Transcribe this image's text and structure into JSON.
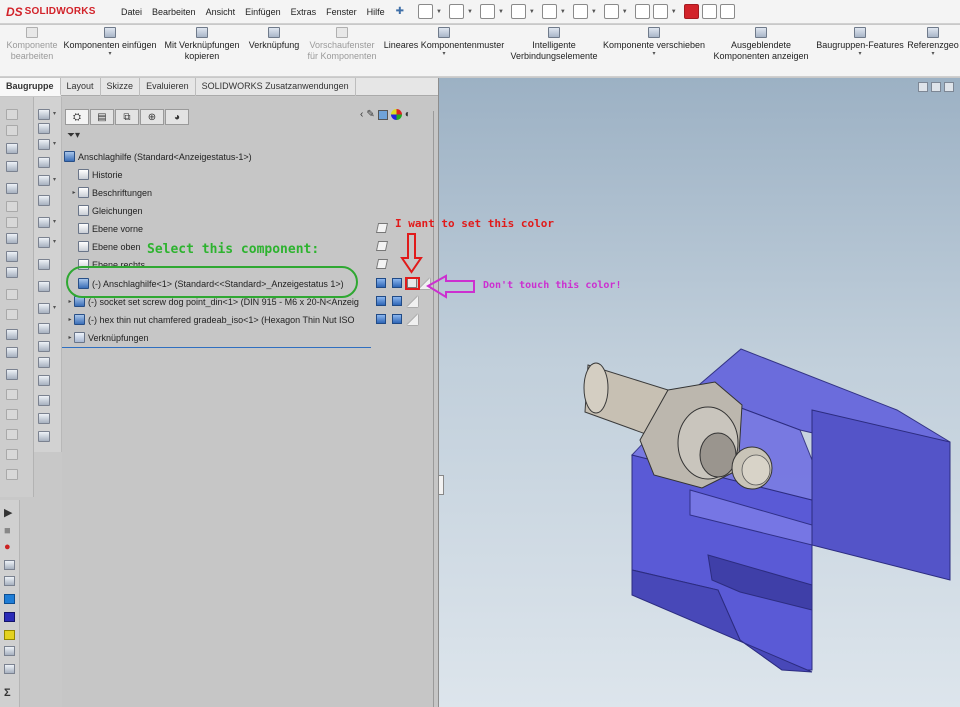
{
  "app": {
    "logo_ds": "DS",
    "logo_text": "SOLIDWORKS"
  },
  "menu": [
    "Datei",
    "Bearbeiten",
    "Ansicht",
    "Einfügen",
    "Extras",
    "Fenster",
    "Hilfe"
  ],
  "commands": [
    {
      "line1": "Komponente",
      "line2": "bearbeiten",
      "disabled": true
    },
    {
      "line1": "Komponenten einfügen",
      "line2": "",
      "disabled": false
    },
    {
      "line1": "Mit Verknüpfungen",
      "line2": "kopieren",
      "disabled": false
    },
    {
      "line1": "Verknüpfung",
      "line2": "",
      "disabled": false
    },
    {
      "line1": "Vorschaufenster",
      "line2": "für Komponenten",
      "disabled": true
    },
    {
      "line1": "Lineares Komponentenmuster",
      "line2": "",
      "disabled": false
    },
    {
      "line1": "Intelligente",
      "line2": "Verbindungselemente",
      "disabled": false
    },
    {
      "line1": "Komponente verschieben",
      "line2": "",
      "disabled": false
    },
    {
      "line1": "Ausgeblendete",
      "line2": "Komponenten anzeigen",
      "disabled": false
    },
    {
      "line1": "Baugruppen-Features",
      "line2": "",
      "disabled": false
    },
    {
      "line1": "Referenzgeo",
      "line2": "",
      "disabled": false
    }
  ],
  "tabs": [
    "Baugruppe",
    "Layout",
    "Skizze",
    "Evaluieren",
    "SOLIDWORKS Zusatzanwendungen"
  ],
  "tree": {
    "root": "Anschlaghilfe  (Standard<Anzeigestatus-1>)",
    "items": [
      {
        "label": "Historie"
      },
      {
        "label": "Beschriftungen"
      },
      {
        "label": "Gleichungen"
      },
      {
        "label": "Ebene vorne"
      },
      {
        "label": "Ebene oben"
      },
      {
        "label": "Ebene rechts"
      },
      {
        "label": "(-) Anschlaghilfe<1> (Standard<<Standard>_Anzeigestatus 1>)"
      },
      {
        "label": "(-) socket set screw dog point_din<1> (DIN 915 - M6 x 20-N<Anzeig"
      },
      {
        "label": "(-) hex thin nut chamfered gradeab_iso<1> (Hexagon Thin Nut ISO"
      },
      {
        "label": "Verknüpfungen"
      }
    ]
  },
  "annotations": {
    "select": "Select this component:",
    "want": "I want to set this color",
    "dont": "Don't touch this color!"
  },
  "colors": {
    "select_green": "#2db32f",
    "want_red": "#e11a1a",
    "dont_magenta": "#cc2fd0",
    "part_body": "#5a5ad6",
    "cylinder": "#c7c0b3"
  },
  "icons": {
    "tab_tree": "feature-manager-icon",
    "tab_prop": "property-manager-icon",
    "tab_config": "configuration-manager-icon",
    "tab_dim": "dimxpert-icon",
    "tab_display": "display-manager-icon"
  }
}
